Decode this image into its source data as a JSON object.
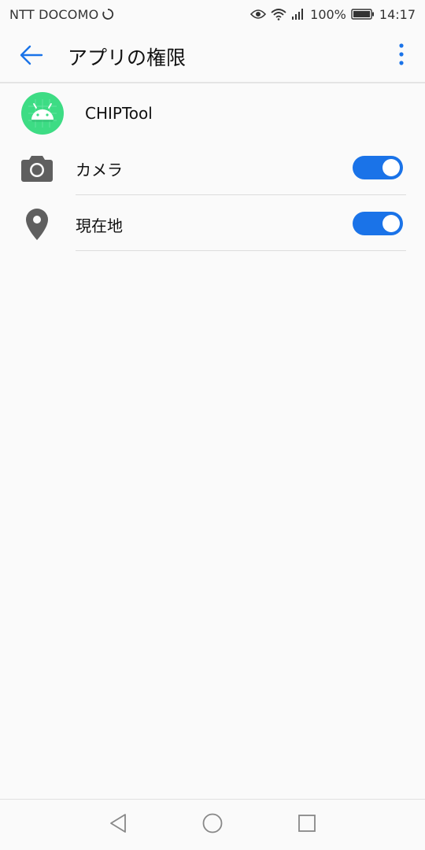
{
  "status_bar": {
    "carrier": "NTT DOCOMO",
    "battery_percent": "100%",
    "time": "14:17"
  },
  "app_bar": {
    "title": "アプリの権限"
  },
  "app": {
    "name": "CHIPTool",
    "icon_color": "#3ddc84"
  },
  "permissions": [
    {
      "label": "カメラ",
      "icon": "camera-icon",
      "enabled": true
    },
    {
      "label": "現在地",
      "icon": "location-pin-icon",
      "enabled": true
    }
  ],
  "colors": {
    "accent": "#1a73e8",
    "icon_gray": "#5f5f5f"
  }
}
